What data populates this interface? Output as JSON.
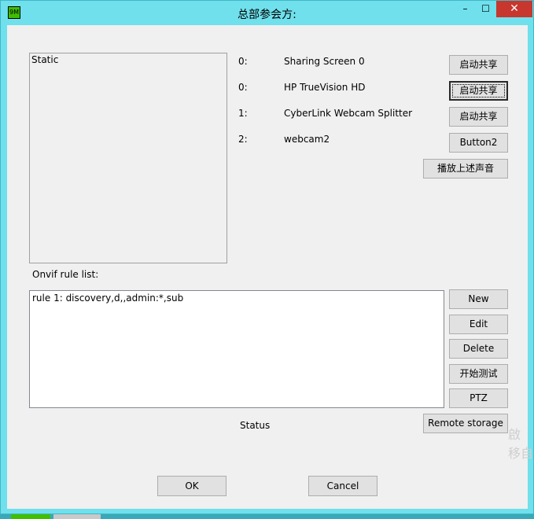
{
  "window": {
    "title": "总部参会方:",
    "controls": {
      "minimize": "–",
      "maximize": "☐",
      "close": "✕"
    },
    "icon_label": "9M"
  },
  "static_box": {
    "text": "Static"
  },
  "devices": [
    {
      "index": "0:",
      "name": "Sharing Screen 0",
      "button": "启动共享"
    },
    {
      "index": "0:",
      "name": "HP TrueVision HD",
      "button": "启动共享"
    },
    {
      "index": "1:",
      "name": "CyberLink Webcam Splitter",
      "button": "启动共享"
    },
    {
      "index": "2:",
      "name": "webcam2",
      "button": "Button2"
    }
  ],
  "play_sound_button": "播放上述声音",
  "rules": {
    "label": "Onvif rule list:",
    "items": [
      "rule 1: discovery,d,,admin:*,sub"
    ],
    "buttons": {
      "new": "New",
      "edit": "Edit",
      "delete": "Delete",
      "start_test": "开始测试",
      "ptz": "PTZ"
    }
  },
  "status": "Status",
  "remote_storage_button": "Remote storage",
  "footer": {
    "ok": "OK",
    "cancel": "Cancel"
  },
  "watermark": {
    "line1": "啟",
    "line2": "移自"
  },
  "colors": {
    "titlebar": "#6fe0ec",
    "close": "#c7372e",
    "client_bg": "#f0f0f0"
  }
}
